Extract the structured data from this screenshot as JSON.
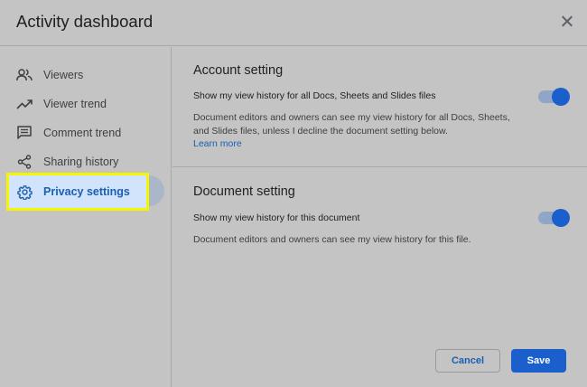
{
  "dialog": {
    "title": "Activity dashboard"
  },
  "sidebar": {
    "items": [
      {
        "label": "Viewers",
        "icon": "people-icon"
      },
      {
        "label": "Viewer trend",
        "icon": "trending-up-icon"
      },
      {
        "label": "Comment trend",
        "icon": "comment-icon"
      },
      {
        "label": "Sharing history",
        "icon": "share-icon"
      },
      {
        "label": "Privacy settings",
        "icon": "gear-icon",
        "active": true
      }
    ]
  },
  "account_setting": {
    "title": "Account setting",
    "toggle_label": "Show my view history for all Docs, Sheets and Slides files",
    "toggle_on": true,
    "description": "Document editors and owners can see my view history for all Docs, Sheets, and Slides files, unless I decline the document setting below.",
    "link": "Learn more"
  },
  "document_setting": {
    "title": "Document setting",
    "toggle_label": "Show my view history for this document",
    "toggle_on": true,
    "description": "Document editors and owners can see my view history for this file."
  },
  "footer": {
    "cancel_label": "Cancel",
    "save_label": "Save"
  },
  "colors": {
    "accent": "#1a5fcc",
    "highlight": "#f5f500"
  }
}
